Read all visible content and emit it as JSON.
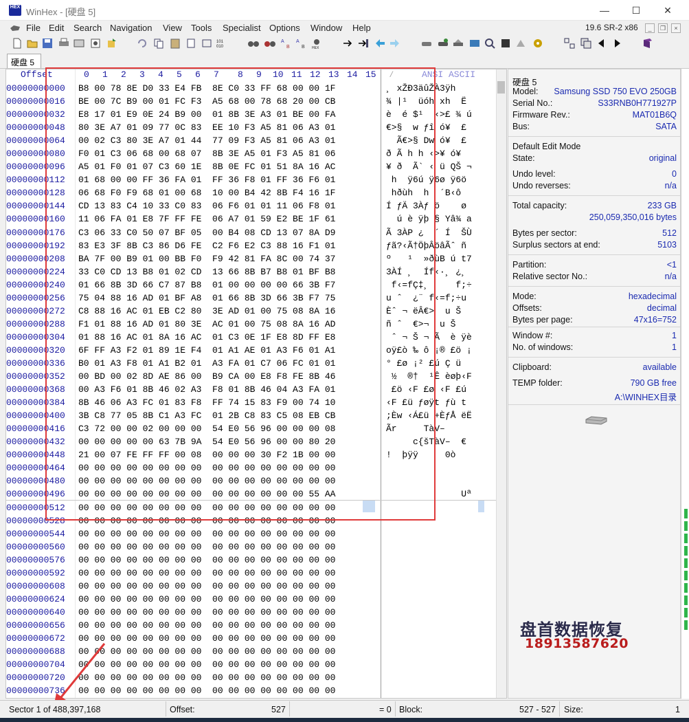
{
  "window": {
    "title": "WinHex - [硬盘 5]",
    "version": "19.6 SR-2 x86",
    "icon_label": "HEX",
    "controls": [
      "—",
      "☐",
      "✕"
    ]
  },
  "menu": [
    "File",
    "Edit",
    "Search",
    "Navigation",
    "View",
    "Tools",
    "Specialist",
    "Options",
    "Window",
    "Help"
  ],
  "tab": {
    "label": "硬盘 5"
  },
  "hex_header": {
    "offset_label": "Offset",
    "columns": [
      "0",
      "1",
      "2",
      "3",
      "4",
      "5",
      "6",
      "7",
      "8",
      "9",
      "10",
      "11",
      "12",
      "13",
      "14",
      "15"
    ],
    "ascii_label": "ANSI ASCII"
  },
  "offsets": [
    "00000000000",
    "00000000016",
    "00000000032",
    "00000000048",
    "00000000064",
    "00000000080",
    "00000000096",
    "00000000112",
    "00000000128",
    "00000000144",
    "00000000160",
    "00000000176",
    "00000000192",
    "00000000208",
    "00000000224",
    "00000000240",
    "00000000256",
    "00000000272",
    "00000000288",
    "00000000304",
    "00000000320",
    "00000000336",
    "00000000352",
    "00000000368",
    "00000000384",
    "00000000400",
    "00000000416",
    "00000000432",
    "00000000448",
    "00000000464",
    "00000000480",
    "00000000496",
    "00000000512",
    "00000000528",
    "00000000544",
    "00000000560",
    "00000000576",
    "00000000592",
    "00000000608",
    "00000000624",
    "00000000640",
    "00000000656",
    "00000000672",
    "00000000688",
    "00000000704",
    "00000000720",
    "00000000736"
  ],
  "hex_rows": [
    "B8 00 78 8E D0 33 E4 FB  8E C0 33 FF 68 00 00 1F",
    "BE 00 7C B9 00 01 FC F3  A5 68 00 78 68 20 00 CB",
    "E8 17 01 E9 0E 24 B9 00  01 8B 3E A3 01 BE 00 FA",
    "80 3E A7 01 09 77 0C 83  EE 10 F3 A5 81 06 A3 01",
    "00 02 C3 80 3E A7 01 44  77 09 F3 A5 81 06 A3 01",
    "F0 01 C3 06 68 00 68 07  8B 3E A5 01 F3 A5 81 06",
    "A5 01 F0 01 07 C3 60 1E  8B 0E FC 01 51 8A 16 AC",
    "01 68 00 00 FF 36 FA 01  FF 36 F8 01 FF 36 F6 01",
    "06 68 F0 F9 68 01 00 68  10 00 B4 42 8B F4 16 1F",
    "CD 13 83 C4 10 33 C0 83  06 F6 01 01 11 06 F8 01",
    "11 06 FA 01 E8 7F FF FE  06 A7 01 59 E2 BE 1F 61",
    "C3 06 33 C0 50 07 BF 05  00 B4 08 CD 13 07 8A D9",
    "83 E3 3F 8B C3 86 D6 FE  C2 F6 E2 C3 88 16 F1 01",
    "BA 7F 00 B9 01 00 BB F0  F9 42 81 FA 8C 00 74 37",
    "33 C0 CD 13 B8 01 02 CD  13 66 8B B7 B8 01 BF B8",
    "01 66 8B 3D 66 C7 87 B8  01 00 00 00 00 66 3B F7",
    "75 04 88 16 AD 01 BF A8  01 66 8B 3D 66 3B F7 75",
    "C8 88 16 AC 01 EB C2 80  3E AD 01 00 75 08 8A 16",
    "F1 01 88 16 AD 01 80 3E  AC 01 00 75 08 8A 16 AD",
    "01 88 16 AC 01 8A 16 AC  01 C3 0E 1F E8 8D FF E8",
    "6F FF A3 F2 01 89 1E F4  01 A1 AE 01 A3 F6 01 A1",
    "B0 01 A3 F8 01 A1 B2 01  A3 FA 01 C7 06 FC 01 01",
    "00 BD 00 02 8D AE 86 00  B9 CA 00 E8 F8 FE 8B 46",
    "00 A3 F6 01 8B 46 02 A3  F8 01 8B 46 04 A3 FA 01",
    "8B 46 06 A3 FC 01 83 F8  FF 74 15 83 F9 00 74 10",
    "3B C8 77 05 8B C1 A3 FC  01 2B C8 83 C5 08 EB CB",
    "C3 72 00 00 02 00 00 00  54 E0 56 96 00 00 00 08",
    "00 00 00 00 00 63 7B 9A  54 E0 56 96 00 00 80 20",
    "21 00 07 FE FF FF 00 08  00 00 00 30 F2 1B 00 00",
    "00 00 00 00 00 00 00 00  00 00 00 00 00 00 00 00",
    "00 00 00 00 00 00 00 00  00 00 00 00 00 00 00 00",
    "00 00 00 00 00 00 00 00  00 00 00 00 00 00 55 AA",
    "00 00 00 00 00 00 00 00  00 00 00 00 00 00 00 00",
    "00 00 00 00 00 00 00 00  00 00 00 00 00 00 00 00",
    "00 00 00 00 00 00 00 00  00 00 00 00 00 00 00 00",
    "00 00 00 00 00 00 00 00  00 00 00 00 00 00 00 00",
    "00 00 00 00 00 00 00 00  00 00 00 00 00 00 00 00",
    "00 00 00 00 00 00 00 00  00 00 00 00 00 00 00 00",
    "00 00 00 00 00 00 00 00  00 00 00 00 00 00 00 00",
    "00 00 00 00 00 00 00 00  00 00 00 00 00 00 00 00",
    "00 00 00 00 00 00 00 00  00 00 00 00 00 00 00 00",
    "00 00 00 00 00 00 00 00  00 00 00 00 00 00 00 00",
    "00 00 00 00 00 00 00 00  00 00 00 00 00 00 00 00",
    "00 00 00 00 00 00 00 00  00 00 00 00 00 00 00 00",
    "00 00 00 00 00 00 00 00  00 00 00 00 00 00 00 00",
    "00 00 00 00 00 00 00 00  00 00 00 00 00 00 00 00",
    "00 00 00 00 00 00 00 00  00 00 00 00 00 00 00 00"
  ],
  "ascii_rows": [
    "¸ xŽÐ3äûŽÀ3ÿh  ",
    "¾ |¹  üóh xh  Ë",
    "è  é $¹  ‹>£ ¾ ú",
    "€>§  w ƒî ó¥  £ ",
    "  Ã€>§ Dw ó¥  £ ",
    "ð Ã h h ‹>¥ ó¥ ",
    "¥ ð  Ã` ‹ ü QŠ ¬",
    " h  ÿ6ú ÿ6ø ÿ6ö ",
    " hðùh  h  ´B‹ô  ",
    "Í ƒÄ 3Àƒ ö    ø ",
    "  ú è ÿþ § Yâ¾ a",
    "Ã 3ÀP ¿  ´ Í  ŠÙ",
    "ƒã?‹Ã†ÖþÂöâÃˆ ñ ",
    "º   ¹  »ðùB ú t7",
    "3ÀÍ ¸  Íf‹·¸ ¿¸",
    " f‹=fÇ‡¸     f;÷",
    "u ˆ ­ ¿¨ f‹=f;÷u",
    "Èˆ ¬ ëÂ€>­  u Š ",
    "ñ ˆ ­ €>¬  u Š ­",
    " ˆ ¬ Š ¬ Ã  è ÿè",
    "oÿ£ò ‰ ô ¡® £ö ¡",
    "° £ø ¡² £ú Ç ü  ",
    " ½  ®†  ¹Ê èøþ‹F",
    " £ö ‹F £ø ‹F £ú ",
    "‹F £ü ƒøÿt ƒù t ",
    ";Èw ‹Á£ü +ÈƒÅ ëË",
    "Ãr     TàV–    ",
    "     c{šTàV–  € ",
    "!  þÿÿ     0ò   ",
    "                ",
    "                ",
    "              Uª",
    "                "
  ],
  "info_panel": {
    "drive_title": "硬盘 5",
    "model_label": "Model:",
    "model_value": "Samsung SSD 750 EVO 250GB",
    "serial_label": "Serial No.:",
    "serial_value": "S33RNB0H771927P",
    "firmware_label": "Firmware Rev.:",
    "firmware_value": "MAT01B6Q",
    "bus_label": "Bus:",
    "bus_value": "SATA",
    "edit_mode_label": "Default Edit Mode",
    "state_label": "State:",
    "state_value": "original",
    "undo_level_label": "Undo level:",
    "undo_level_value": "0",
    "undo_rev_label": "Undo reverses:",
    "undo_rev_value": "n/a",
    "capacity_label": "Total capacity:",
    "capacity_value": "233 GB",
    "capacity_bytes": "250,059,350,016 bytes",
    "bps_label": "Bytes per sector:",
    "bps_value": "512",
    "surplus_label": "Surplus sectors at end:",
    "surplus_value": "5103",
    "partition_label": "Partition:",
    "partition_value": "<1",
    "relsec_label": "Relative sector No.:",
    "relsec_value": "n/a",
    "mode_label": "Mode:",
    "mode_value": "hexadecimal",
    "offsets_label": "Offsets:",
    "offsets_value": "decimal",
    "bpp_label": "Bytes per page:",
    "bpp_value": "47x16=752",
    "window_no_label": "Window #:",
    "window_no_value": "1",
    "nwin_label": "No. of windows:",
    "nwin_value": "1",
    "clipboard_label": "Clipboard:",
    "clipboard_value": "available",
    "temp_label": "TEMP folder:",
    "temp_value": "790 GB free",
    "temp_path": "A:\\WINHEX目录"
  },
  "watermark": {
    "line1": "盘首数据恢复",
    "line2": "18913587620"
  },
  "status": {
    "sector": "Sector 1 of 488,397,168",
    "offset_label": "Offset:",
    "offset_value": "527",
    "eq_value": "= 0",
    "block_label": "Block:",
    "block_value": "527 - 527",
    "size_label": "Size:",
    "size_value": "1"
  },
  "colors": {
    "accent_blue": "#1a2ab0",
    "offset_blue": "#1a1aa0",
    "annotation_red": "#e03a3a",
    "watermark_red": "#b91c1c",
    "green_bar": "#2fb54a"
  }
}
